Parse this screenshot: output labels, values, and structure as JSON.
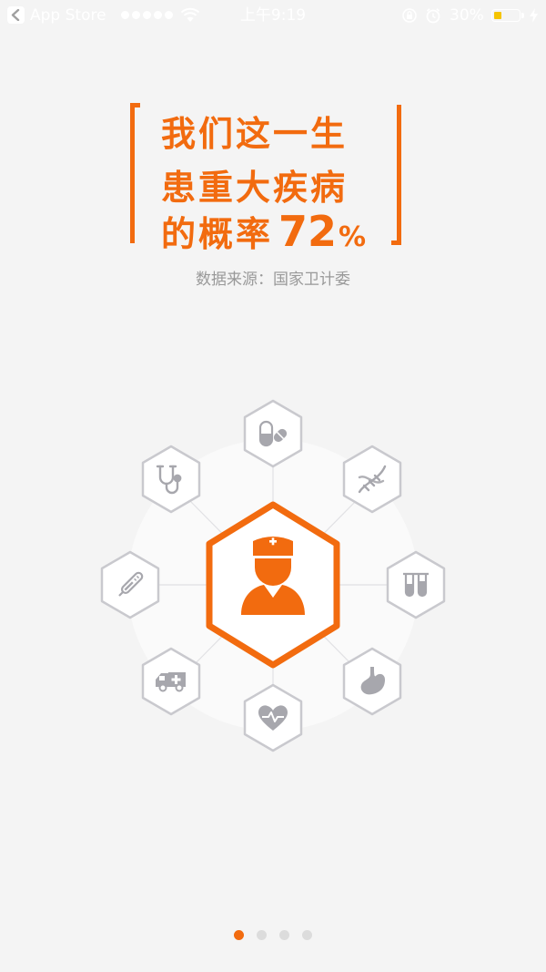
{
  "status_bar": {
    "back_app": "App Store",
    "time": "上午9:19",
    "battery_percent": "30%",
    "battery_level": 0.3
  },
  "headline": {
    "line1": "我们这一生",
    "line2": "患重大疾病",
    "line3_prefix": "的概率",
    "line3_number": "72",
    "line3_unit": "%"
  },
  "source_note": "数据来源：国家卫计委",
  "colors": {
    "accent": "#f26b0f",
    "icon_gray": "#a7a7ad",
    "background": "#f4f4f4"
  },
  "wheel": {
    "center_icon": "doctor-icon",
    "icons": [
      "pill-capsule-icon",
      "dna-icon",
      "test-tubes-icon",
      "stomach-icon",
      "heart-pulse-icon",
      "ambulance-icon",
      "thermometer-icon",
      "stethoscope-icon"
    ]
  },
  "pager": {
    "page_count": 4,
    "current_page": 1
  }
}
